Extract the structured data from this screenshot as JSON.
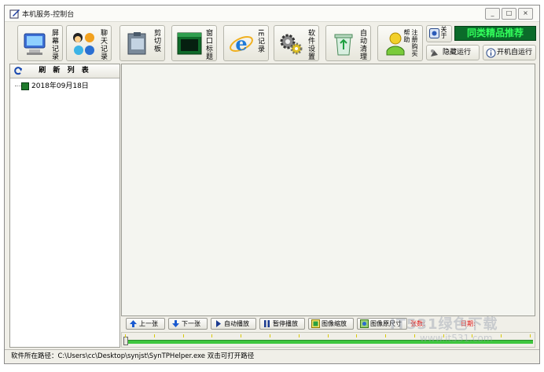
{
  "window": {
    "title": "本机服务-控制台",
    "controls": [
      "_",
      "□",
      "×"
    ]
  },
  "toolbar": {
    "buttons": [
      {
        "label": "屏幕记录",
        "icon": "monitor-icon"
      },
      {
        "label": "聊天记录",
        "icon": "chat-people-icon"
      },
      {
        "label": "剪切板",
        "icon": "clipboard-icon"
      },
      {
        "label": "窗口标题",
        "icon": "window-icon"
      },
      {
        "label": "IE记录",
        "icon": "ie-icon"
      },
      {
        "label": "软件设置",
        "icon": "gears-icon"
      },
      {
        "label": "自动清理",
        "icon": "recycle-bin-icon"
      },
      {
        "label": "注册购买帮助",
        "icon": "key-hand-icon"
      }
    ],
    "about_label": "关于",
    "hide_run_label": "隐藏运行",
    "autostart_label": "开机自运行",
    "promo_label": "同类精品推荐"
  },
  "left_panel": {
    "refresh_label": "刷 新 列 表",
    "tree_items": [
      "2018年09月18日"
    ]
  },
  "playback": {
    "prev_label": "上一张",
    "next_label": "下一张",
    "auto_play_label": "自动播放",
    "pause_label": "暂停播放",
    "zoom_label": "图像缩放",
    "original_size_label": "图像原尺寸",
    "speed_label": "张数:",
    "date_label": "日期:",
    "position": 0
  },
  "status": {
    "text": "软件所在路径：C:\\Users\\cc\\Desktop\\synjst\\SynTPHelper.exe 双击可打开路径"
  },
  "watermark": {
    "line1": "IT531绿色下载",
    "line2": "www.it531.com"
  },
  "colors": {
    "promo_bg": "#0b6b2a",
    "promo_text": "#32ff5c",
    "slider_track": "#3ec63e",
    "warning_text": "#e01010"
  }
}
